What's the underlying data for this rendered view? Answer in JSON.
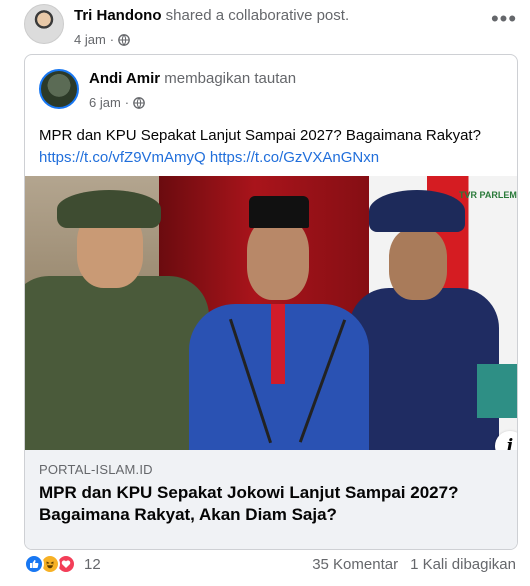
{
  "post": {
    "author": "Tri Handono",
    "action": "shared a collaborative post.",
    "time": "4 jam",
    "privacy_icon": "globe-icon",
    "more_label": "•••"
  },
  "shared_post": {
    "author": "Andi Amir",
    "action": "membagikan tautan",
    "time": "6 jam",
    "privacy_icon": "globe-icon",
    "text": "MPR dan KPU Sepakat Lanjut Sampai 2027? Bagaimana Rakyat?",
    "links": "https://t.co/vfZ9VmAmyQ https://t.co/GzVXAnGNxn"
  },
  "link_preview": {
    "image_logo": "TVR PARLEMEN",
    "info_label": "i",
    "domain": "PORTAL-ISLAM.ID",
    "headline": "MPR dan KPU Sepakat Jokowi Lanjut Sampai 2027? Bagaimana Rakyat, Akan Diam Saja?"
  },
  "footer": {
    "reaction_icons": [
      "like-icon",
      "haha-icon",
      "love-icon"
    ],
    "reaction_count": "12",
    "comments": "35 Komentar",
    "shares": "1 Kali dibagikan"
  },
  "colors": {
    "link": "#216fdb",
    "secondary_text": "#65676b",
    "like": "#1877f2",
    "haha": "#f7b125",
    "love": "#f33e58"
  }
}
